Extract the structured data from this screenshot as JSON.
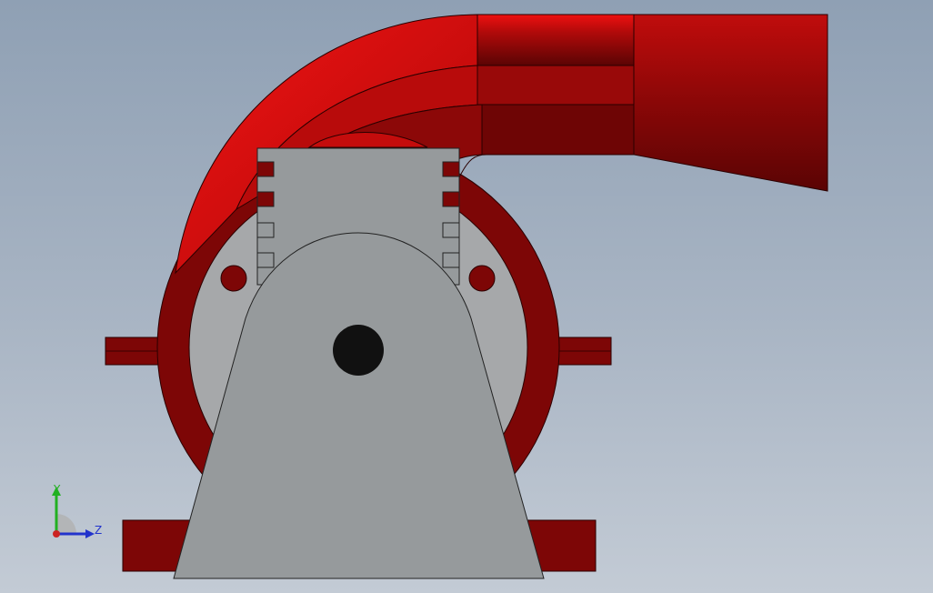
{
  "viewport": {
    "background_top": "#8fa0b4",
    "background_bottom": "#c3cbd5"
  },
  "model": {
    "housing_color": "#7d0606",
    "duct_color": "#d40d0d",
    "bracket_color": "#969a9c",
    "shaft_color": "#111111"
  },
  "triad": {
    "y_label": "Y",
    "z_label": "Z",
    "y_color": "#22b022",
    "z_color": "#2233cc",
    "x_color": "#cc2222"
  }
}
